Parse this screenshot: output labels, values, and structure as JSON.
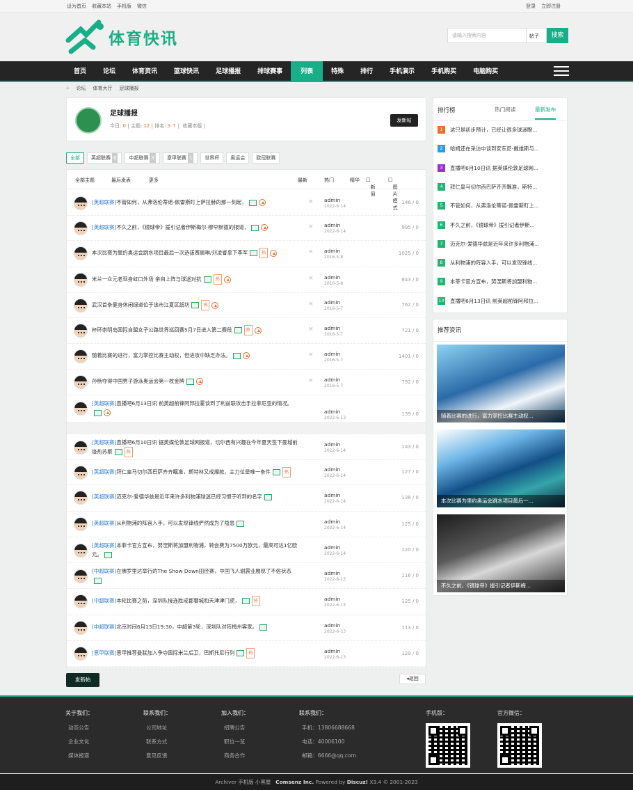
{
  "topbar": {
    "left": [
      "设为首页",
      "收藏本站",
      "手机版",
      "微信"
    ],
    "right": [
      "登录",
      "立即注册"
    ]
  },
  "brand": {
    "name": "体育快讯",
    "accent": "#17ae88"
  },
  "search": {
    "placeholder": "请输入搜索内容",
    "type": "帖子",
    "button": "搜索"
  },
  "nav": {
    "items": [
      "首页",
      "论坛",
      "体育资讯",
      "篮球快讯",
      "足球播报",
      "排球赛事",
      "列表",
      "特殊",
      "排行",
      "手机演示",
      "手机购买",
      "电脑购买"
    ],
    "active": "列表"
  },
  "breadcrumb": [
    "论坛",
    "体育大厅",
    "足球播报"
  ],
  "forum": {
    "name": "足球播报",
    "today_label": "今日:",
    "today": "0",
    "threads_label": "主题:",
    "threads": "12",
    "rank_label": "排名:",
    "rank": "3",
    "mode": "收藏本版",
    "post_btn": "发新帖"
  },
  "categories": [
    {
      "label": "全部",
      "n": ""
    },
    {
      "label": "英超联赛",
      "n": "6"
    },
    {
      "label": "中超联赛",
      "n": "3"
    },
    {
      "label": "意甲联赛",
      "n": "1"
    },
    {
      "label": "世界杯",
      "n": ""
    },
    {
      "label": "奥运会",
      "n": ""
    },
    {
      "label": "欧冠联赛",
      "n": ""
    }
  ],
  "list_head": {
    "all": "全部主题",
    "latest_post": "最后发表",
    "more": "更多",
    "newest": "最新",
    "hot": "热门",
    "digest": "精华",
    "new_window": "新窗",
    "pic_mode": "图片模式"
  },
  "threads": [
    {
      "tag": "[英超联赛]",
      "title": "不管如何，从弗洛伦蒂诺-佩雷斯盯上萨拉赫的那一刻起，",
      "author": "admin",
      "date": "2022-6-14",
      "count": "146 / 0",
      "pic": true,
      "up": true,
      "hot": false
    },
    {
      "tag": "[英超联赛]",
      "title": "不久之前，《镜球帝》援引记者伊斯梅尔·穆罕默德的报道，",
      "author": "admin",
      "date": "2022-6-14",
      "count": "995 / 0",
      "pic": true,
      "up": true,
      "hot": false
    },
    {
      "tag": "",
      "title": "本次比赛为里约奥运会跳水项目最后一次选拔赛居琳/刘凌睿拿下季军",
      "author": "admin",
      "date": "2016-5-8",
      "count": "1025 / 0",
      "pic": true,
      "up": true,
      "hot": true
    },
    {
      "tag": "",
      "title": "米兰一众元老现身虹口外场 亲自上阵与球迷对抗",
      "author": "admin",
      "date": "2016-5-8",
      "count": "843 / 0",
      "pic": true,
      "up": true,
      "hot": true
    },
    {
      "tag": "",
      "title": "武汉首条健身休闲绿道位于该市江夏区纸坊",
      "author": "admin",
      "date": "2016-5-7",
      "count": "762 / 0",
      "pic": true,
      "up": true,
      "hot": true
    },
    {
      "tag": "",
      "title": "杯环崇明岛国际自盟女子公路世界巡回赛5月7日进入第二赛段",
      "author": "admin",
      "date": "2016-5-7",
      "count": "721 / 0",
      "pic": true,
      "up": true,
      "hot": true
    },
    {
      "tag": "",
      "title": "随着比赛的进行，富力掌控比赛主动权，但进攻中缺乏办法。",
      "author": "admin",
      "date": "2016-5-7",
      "count": "1401 / 0",
      "pic": true,
      "up": true,
      "hot": false
    },
    {
      "tag": "",
      "title": "孙杨夺得中国男子游泳奥运会第一枚金牌",
      "author": "admin",
      "date": "2016-5-7",
      "count": "792 / 0",
      "pic": true,
      "up": true,
      "hot": false
    },
    {
      "tag": "[英超联赛]",
      "title": "直播吧6月13日讯 前英超前锋阿邦拉霍谈到了利兹联攻击手拉菲尼亚的情况。",
      "author": "admin",
      "date": "2022-6-13",
      "count": "139 / 0",
      "pic": true,
      "up": true,
      "hot": false
    },
    {
      "tag": "[英超联赛]",
      "title": "直播吧6月10日讯 据英媒伦敦足球网报道，切尔西有兴趣在今年夏天签下曼城前锋热苏斯",
      "author": "admin",
      "date": "2022-6-14",
      "count": "143 / 0",
      "pic": true,
      "up": false,
      "hot": true
    },
    {
      "tag": "[英超联赛]",
      "title": "拜仁皇马切尔西巴萨齐齐瞩准，斯特林又成爆款，主力位是唯一条件",
      "author": "admin",
      "date": "2022-6-14",
      "count": "127 / 0",
      "pic": true,
      "up": false,
      "hot": true
    },
    {
      "tag": "[英超联赛]",
      "title": "迈克尔-爱德华兹是近年来许多利物浦球迷已经习惯于听到的名字",
      "author": "admin",
      "date": "2022-6-14",
      "count": "138 / 0",
      "pic": true,
      "up": false,
      "hot": false
    },
    {
      "tag": "[英超联赛]",
      "title": "从利物浦的阵容入手，可以发现锋线俨然成为了隐患",
      "author": "admin",
      "date": "2022-6-14",
      "count": "125 / 0",
      "pic": true,
      "up": false,
      "hot": false
    },
    {
      "tag": "[英超联赛]",
      "title": "本菲卡官方宣布，努涅斯将加盟利物浦，转会费为7500万欧元，最高可达1亿欧元。",
      "author": "admin",
      "date": "2022-6-14",
      "count": "120 / 0",
      "pic": true,
      "up": false,
      "hot": false
    },
    {
      "tag": "[中超联赛]",
      "title": "在佛罗里达举行的The Show Down田径赛，中国飞人谢震业展现了不俗状态",
      "author": "admin",
      "date": "2022-6-13",
      "count": "116 / 0",
      "pic": true,
      "up": false,
      "hot": false
    },
    {
      "tag": "[中超联赛]",
      "title": "本轮比赛之前，深圳队接连胜成都蓉城和天津津门虎，",
      "author": "admin",
      "date": "2022-6-13",
      "count": "125 / 0",
      "pic": true,
      "up": false,
      "hot": true
    },
    {
      "tag": "[中超联赛]",
      "title": "北京时间6月13日19:30，中超第3轮，深圳队对阵梅州客家。",
      "author": "admin",
      "date": "2022-6-13",
      "count": "113 / 0",
      "pic": true,
      "up": false,
      "hot": false
    },
    {
      "tag": "[意甲联赛]",
      "title": "意甲推荐曼联加入争夺国际米兰后卫，巴斯托尼行列",
      "author": "admin",
      "date": "2022-6-13",
      "count": "129 / 0",
      "pic": true,
      "up": false,
      "hot": true
    }
  ],
  "post_btn": "发新帖",
  "back": "返回",
  "rank": {
    "title": "排行榜",
    "tab1": "热门阅读",
    "tab2": "最新发布",
    "items": [
      "这只是初步预计，已经让很多球迷瞪...",
      "哈姆还在采访中谈到安东尼-戴维斯与...",
      "直播吧6月10日讯 据英媒伦敦足球网...",
      "拜仁皇马切尔西巴萨齐齐瞩准，斯特...",
      "不管如何，从弗洛伦蒂诺-佩雷斯盯上...",
      "不久之前，《镜球帝》援引记者伊斯...",
      "迈克尔-爱德华兹是近年来许多利物浦...",
      "从利物浦的阵容入手，可以发现锋线...",
      "本菲卡官方宣布，努涅斯将加盟利物...",
      "直播吧6月13日讯 前英超前锋阿邦拉..."
    ],
    "colors": [
      "#f26b2a",
      "#2d9be4",
      "#9b30d9",
      "#21b574",
      "#21b574",
      "#21b574",
      "#21b574",
      "#21b574",
      "#21b574",
      "#21b574"
    ]
  },
  "recommend": {
    "title": "推荐资讯",
    "items": [
      "随着比赛的进行，富力掌控比赛主动权...",
      "本次比赛为里约奥运会跳水项目最后一...",
      "不久之前，《镜球帝》援引记者伊斯梅..."
    ]
  },
  "footer": {
    "cols": [
      {
        "title": "关于我们：",
        "items": [
          "动态公告",
          "企业文化",
          "媒体报道"
        ]
      },
      {
        "title": "联系我们：",
        "items": [
          "公司地址",
          "联系方式",
          "意见反馈"
        ]
      },
      {
        "title": "加入我们：",
        "items": [
          "招聘公告",
          "职位一览",
          "商务合作"
        ]
      },
      {
        "title": "联系我们：",
        "items": [
          "手机：13806688668",
          "电话：40006100",
          "邮箱：6666@qq.com"
        ]
      }
    ],
    "mobile": "手机版：",
    "wechat": "官方微信："
  },
  "copyright": {
    "links": "Archiver   手机版   小黑屋",
    "company": "Comsenz Inc.",
    "powered": "Powered by",
    "discuz": "Discuz!",
    "ver": "X3.4 © 2001-2023"
  }
}
